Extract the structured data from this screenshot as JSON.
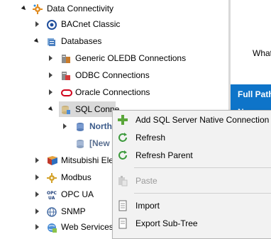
{
  "tree": {
    "root": {
      "label": "Data Connectivity"
    },
    "bacnet": {
      "label": "BACnet Classic"
    },
    "databases": {
      "label": "Databases"
    },
    "oledb": {
      "label": "Generic OLEDB Connections"
    },
    "odbc": {
      "label": "ODBC Connections"
    },
    "oracle": {
      "label": "Oracle Connections"
    },
    "sql": {
      "label": "SQL Conne"
    },
    "north": {
      "label": "North"
    },
    "new": {
      "label": "[New"
    },
    "mitsubishi": {
      "label": "Mitsubishi Ele"
    },
    "modbus": {
      "label": "Modbus"
    },
    "opcua": {
      "label": "OPC UA"
    },
    "snmp": {
      "label": "SNMP"
    },
    "webservices": {
      "label": "Web Services"
    }
  },
  "right_panel": {
    "what": "What",
    "full_path": "Full Path:",
    "name": "Name:"
  },
  "context_menu": {
    "add": "Add SQL Server Native Connection",
    "refresh": "Refresh",
    "refresh_parent": "Refresh Parent",
    "paste": "Paste",
    "import": "Import",
    "export": "Export Sub-Tree"
  },
  "colors": {
    "accent": "#0e74c9",
    "selection": "#d9d9d9",
    "menu_bg": "#f2f2f2"
  }
}
